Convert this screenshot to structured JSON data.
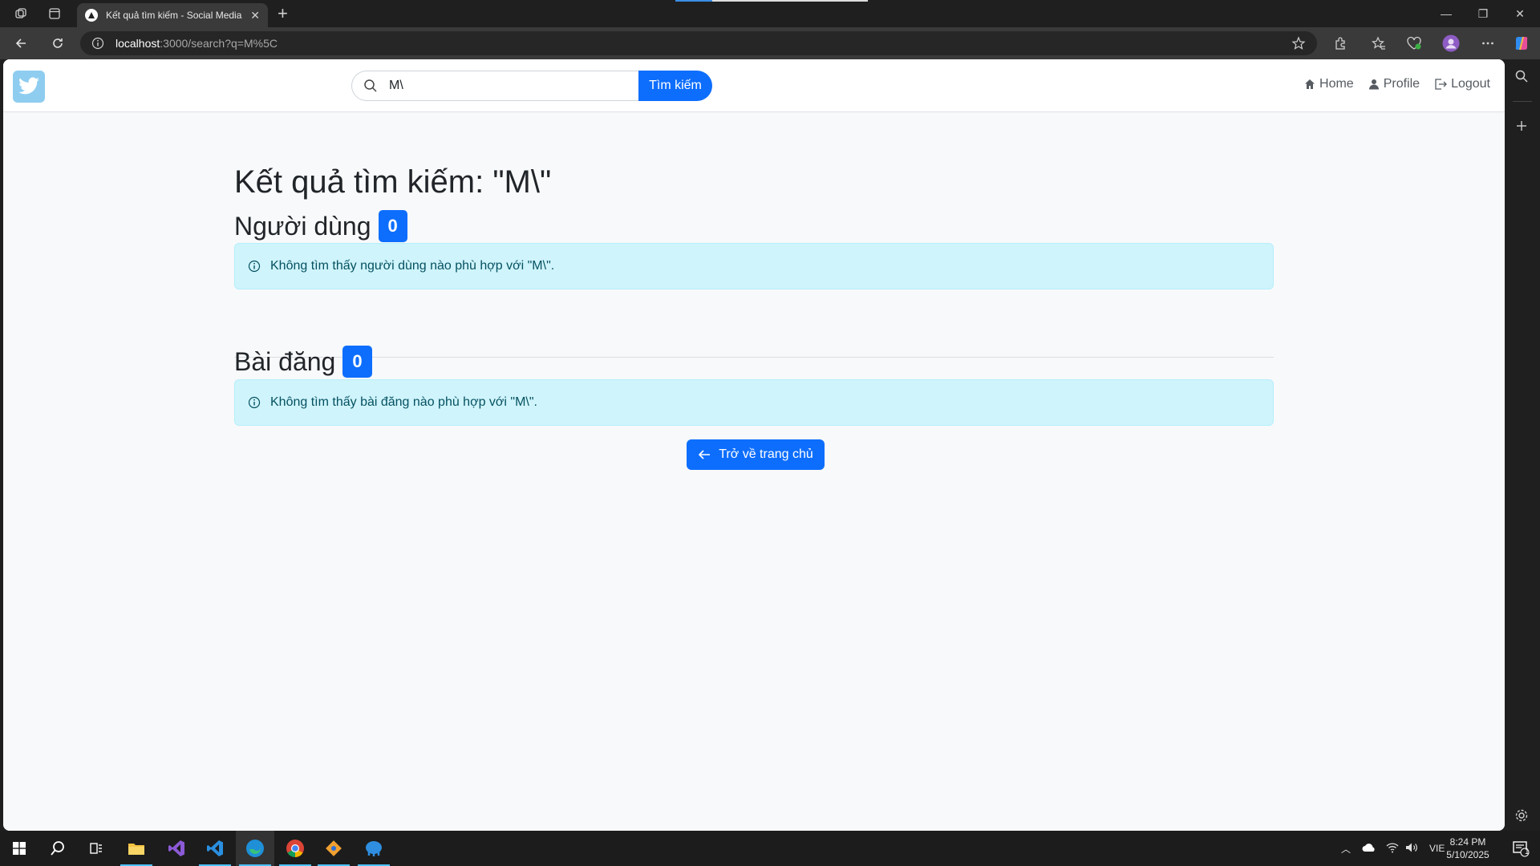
{
  "browser": {
    "tab_title": "Kết quả tìm kiếm - Social Media V",
    "url_host": "localhost",
    "url_rest": ":3000/search?q=M%5C"
  },
  "navbar": {
    "search_value": "M\\",
    "search_button": "Tìm kiếm",
    "links": [
      "Home",
      "Profile",
      "Logout"
    ]
  },
  "page": {
    "title": "Kết quả tìm kiếm: \"M\\\"",
    "users_section": {
      "heading": "Người dùng",
      "count": "0",
      "message": "Không tìm thấy người dùng nào phù hợp với \"M\\\"."
    },
    "posts_section": {
      "heading": "Bài đăng",
      "count": "0",
      "message": "Không tìm thấy bài đăng nào phù hợp với \"M\\\"."
    },
    "back_button": "Trở về trang chủ"
  },
  "taskbar": {
    "language": "VIE",
    "time": "8:24 PM",
    "date": "5/10/2025",
    "notification_count": "1"
  },
  "colors": {
    "primary": "#0d6efd",
    "alert_bg": "#cff4fc",
    "alert_text": "#055160",
    "logo_bg": "#8ecdf0"
  }
}
